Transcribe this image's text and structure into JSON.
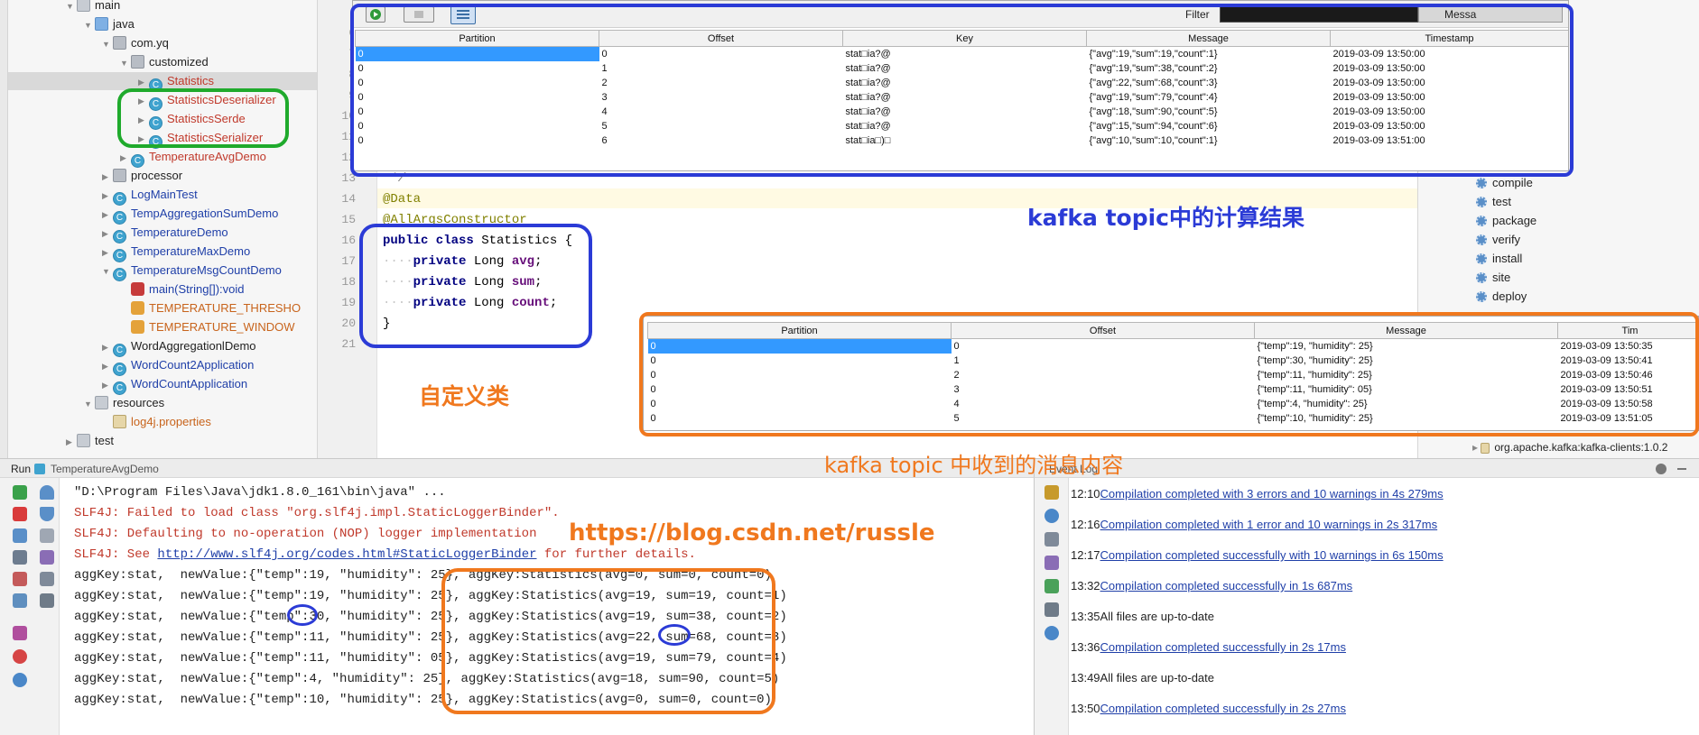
{
  "tree": {
    "items": [
      {
        "label": "main",
        "indent": 1,
        "icon": "folder",
        "twisty": "down"
      },
      {
        "label": "java",
        "indent": 2,
        "icon": "srcfolder",
        "twisty": "down"
      },
      {
        "label": "com.yq",
        "indent": 3,
        "icon": "pkg",
        "twisty": "down"
      },
      {
        "label": "customized",
        "indent": 4,
        "icon": "pkg",
        "twisty": "down"
      },
      {
        "label": "Statistics",
        "indent": 5,
        "icon": "cls",
        "twisty": "right",
        "color": "red",
        "selected": true
      },
      {
        "label": "StatisticsDeserializer",
        "indent": 5,
        "icon": "cls",
        "twisty": "right",
        "color": "red"
      },
      {
        "label": "StatisticsSerde",
        "indent": 5,
        "icon": "cls",
        "twisty": "right",
        "color": "red"
      },
      {
        "label": "StatisticsSerializer",
        "indent": 5,
        "icon": "cls",
        "twisty": "right",
        "color": "red"
      },
      {
        "label": "TemperatureAvgDemo",
        "indent": 4,
        "icon": "cls",
        "twisty": "right",
        "color": "red"
      },
      {
        "label": "processor",
        "indent": 3,
        "icon": "pkg",
        "twisty": "right",
        "color": "dark"
      },
      {
        "label": "LogMainTest",
        "indent": 3,
        "icon": "cls",
        "twisty": "right",
        "color": "blue"
      },
      {
        "label": "TempAggregationSumDemo",
        "indent": 3,
        "icon": "cls",
        "twisty": "right",
        "color": "blue"
      },
      {
        "label": "TemperatureDemo",
        "indent": 3,
        "icon": "cls",
        "twisty": "right",
        "color": "blue"
      },
      {
        "label": "TemperatureMaxDemo",
        "indent": 3,
        "icon": "cls",
        "twisty": "right",
        "color": "blue"
      },
      {
        "label": "TemperatureMsgCountDemo",
        "indent": 3,
        "icon": "cls",
        "twisty": "down",
        "color": "blue"
      },
      {
        "label": "main(String[]):void",
        "indent": 4,
        "icon": "method",
        "twisty": "",
        "color": "blue"
      },
      {
        "label": "TEMPERATURE_THRESHO",
        "indent": 4,
        "icon": "field",
        "twisty": "",
        "color": "orange"
      },
      {
        "label": "TEMPERATURE_WINDOW",
        "indent": 4,
        "icon": "field",
        "twisty": "",
        "color": "orange"
      },
      {
        "label": "WordAggregationlDemo",
        "indent": 3,
        "icon": "cls",
        "twisty": "right",
        "color": "dark"
      },
      {
        "label": "WordCount2Application",
        "indent": 3,
        "icon": "cls",
        "twisty": "right",
        "color": "blue"
      },
      {
        "label": "WordCountApplication",
        "indent": 3,
        "icon": "cls",
        "twisty": "right",
        "color": "blue"
      },
      {
        "label": "resources",
        "indent": 2,
        "icon": "folder",
        "twisty": "down",
        "color": "dark"
      },
      {
        "label": "log4j.properties",
        "indent": 3,
        "icon": "props",
        "twisty": "",
        "color": "orange"
      },
      {
        "label": "test",
        "indent": 1,
        "icon": "folder",
        "twisty": "right",
        "color": "dark"
      }
    ]
  },
  "editor": {
    "lines": [
      {
        "num": "6",
        "html": ""
      },
      {
        "num": "7",
        "html": ""
      },
      {
        "num": "8",
        "html": ""
      },
      {
        "num": "9",
        "html": ""
      },
      {
        "num": "10",
        "html": ""
      },
      {
        "num": "11",
        "html": ""
      },
      {
        "num": "12",
        "html": ""
      },
      {
        "num": "13",
        "code": " */",
        "cls": "cmt"
      },
      {
        "num": "14",
        "code": "@Data",
        "cls": "ann",
        "highlight": true
      },
      {
        "num": "15",
        "code": "@AllArgsConstructor",
        "cls": "ann"
      },
      {
        "num": "16",
        "code": "public class Statistics {",
        "cls": "decl"
      },
      {
        "num": "17",
        "code": "    private Long avg;",
        "cls": "field",
        "field": "avg"
      },
      {
        "num": "18",
        "code": "    private Long sum;",
        "cls": "field",
        "field": "sum"
      },
      {
        "num": "19",
        "code": "    private Long count;",
        "cls": "field",
        "field": "count"
      },
      {
        "num": "20",
        "code": "}",
        "cls": "plain"
      },
      {
        "num": "21",
        "code": "",
        "cls": "plain"
      }
    ]
  },
  "maven": {
    "lifecycle": [
      "compile",
      "test",
      "package",
      "verify",
      "install",
      "site",
      "deploy"
    ],
    "dependency": "org.apache.kafka:kafka-clients:1.0.2"
  },
  "kafka_result": {
    "filter_label": "Filter",
    "message_label": "Messa",
    "toolbar": [
      "play-icon",
      "stop-icon",
      "list-icon"
    ],
    "headers": [
      "Partition",
      "Offset",
      "Key",
      "Message",
      "Timestamp"
    ],
    "rows": [
      [
        "0",
        "0",
        "stat□ia?@",
        "{\"avg\":19,\"sum\":19,\"count\":1}",
        "2019-03-09 13:50:00"
      ],
      [
        "0",
        "1",
        "stat□ia?@",
        "{\"avg\":19,\"sum\":38,\"count\":2}",
        "2019-03-09 13:50:00"
      ],
      [
        "0",
        "2",
        "stat□ia?@",
        "{\"avg\":22,\"sum\":68,\"count\":3}",
        "2019-03-09 13:50:00"
      ],
      [
        "0",
        "3",
        "stat□ia?@",
        "{\"avg\":19,\"sum\":79,\"count\":4}",
        "2019-03-09 13:50:00"
      ],
      [
        "0",
        "4",
        "stat□ia?@",
        "{\"avg\":18,\"sum\":90,\"count\":5}",
        "2019-03-09 13:50:00"
      ],
      [
        "0",
        "5",
        "stat□ia?@",
        "{\"avg\":15,\"sum\":94,\"count\":6}",
        "2019-03-09 13:50:00"
      ],
      [
        "0",
        "6",
        "stat□ia□)□",
        "{\"avg\":10,\"sum\":10,\"count\":1}",
        "2019-03-09 13:51:00"
      ]
    ]
  },
  "kafka_messages": {
    "headers": [
      "Partition",
      "Offset",
      "Message",
      "Tim"
    ],
    "rows": [
      [
        "0",
        "0",
        "{\"temp\":19, \"humidity\": 25}",
        "2019-03-09 13:50:35"
      ],
      [
        "0",
        "1",
        "{\"temp\":30, \"humidity\": 25}",
        "2019-03-09 13:50:41"
      ],
      [
        "0",
        "2",
        "{\"temp\":11, \"humidity\": 25}",
        "2019-03-09 13:50:46"
      ],
      [
        "0",
        "3",
        "{\"temp\":11, \"humidity\": 05}",
        "2019-03-09 13:50:51"
      ],
      [
        "0",
        "4",
        "{\"temp\":4, \"humidity\": 25}",
        "2019-03-09 13:50:58"
      ],
      [
        "0",
        "5",
        "{\"temp\":10, \"humidity\": 25}",
        "2019-03-09 13:51:05"
      ]
    ]
  },
  "run": {
    "tab_label": "Run",
    "config_name": "TemperatureAvgDemo",
    "lines": [
      {
        "text": "\"D:\\Program Files\\Java\\jdk1.8.0_161\\bin\\java\" ...",
        "style": "dark"
      },
      {
        "text": "SLF4J: Failed to load class \"org.slf4j.impl.StaticLoggerBinder\".",
        "style": "red"
      },
      {
        "text": "SLF4J: Defaulting to no-operation (NOP) logger implementation",
        "style": "red"
      },
      {
        "pre": "SLF4J: See ",
        "link": "http://www.slf4j.org/codes.html#StaticLoggerBinder",
        "post": " for further details.",
        "style": "red"
      },
      {
        "text": "aggKey:stat,  newValue:{\"temp\":19, \"humidity\": 25}, aggKey:Statistics(avg=0, sum=0, count=0)",
        "style": "dark"
      },
      {
        "text": "aggKey:stat,  newValue:{\"temp\":19, \"humidity\": 25}, aggKey:Statistics(avg=19, sum=19, count=1)",
        "style": "dark"
      },
      {
        "text": "aggKey:stat,  newValue:{\"temp\":30, \"humidity\": 25}, aggKey:Statistics(avg=19, sum=38, count=2)",
        "style": "dark"
      },
      {
        "text": "aggKey:stat,  newValue:{\"temp\":11, \"humidity\": 25}, aggKey:Statistics(avg=22, sum=68, count=3)",
        "style": "dark"
      },
      {
        "text": "aggKey:stat,  newValue:{\"temp\":11, \"humidity\": 05}, aggKey:Statistics(avg=19, sum=79, count=4)",
        "style": "dark"
      },
      {
        "text": "aggKey:stat,  newValue:{\"temp\":4, \"humidity\": 25}, aggKey:Statistics(avg=18, sum=90, count=5)",
        "style": "dark"
      },
      {
        "text": "aggKey:stat,  newValue:{\"temp\":10, \"humidity\": 25}, aggKey:Statistics(avg=0, sum=0, count=0)",
        "style": "dark"
      }
    ]
  },
  "event_log": {
    "title": "Event Log",
    "entries": [
      {
        "time": "12:10",
        "msg": "Compilation completed with 3 errors and 10 warnings in 4s 279ms",
        "link": true
      },
      {
        "time": "12:16",
        "msg": "Compilation completed with 1 error and 10 warnings in 2s 317ms",
        "link": true
      },
      {
        "time": "12:17",
        "msg": "Compilation completed successfully with 10 warnings in 6s 150ms",
        "link": true
      },
      {
        "time": "13:32",
        "msg": "Compilation completed successfully in 1s 687ms",
        "link": true
      },
      {
        "time": "13:35",
        "msg": "All files are up-to-date",
        "link": false
      },
      {
        "time": "13:36",
        "msg": "Compilation completed successfully in 2s 17ms",
        "link": true
      },
      {
        "time": "13:49",
        "msg": "All files are up-to-date",
        "link": false
      },
      {
        "time": "13:50",
        "msg": "Compilation completed successfully in 2s 27ms",
        "link": true
      }
    ]
  },
  "annotations": {
    "kafka_result_note": "kafka topic中的计算结果",
    "custom_class_note": "自定义类",
    "kafka_messages_note": "kafka topic 中收到的消息内容",
    "watermark": "https://blog.csdn.net/russle"
  },
  "colors": {
    "blue_box": "#2b3bd6",
    "green_box": "#1faa2c",
    "orange_box": "#f0781e",
    "selection": "#3399ff"
  }
}
